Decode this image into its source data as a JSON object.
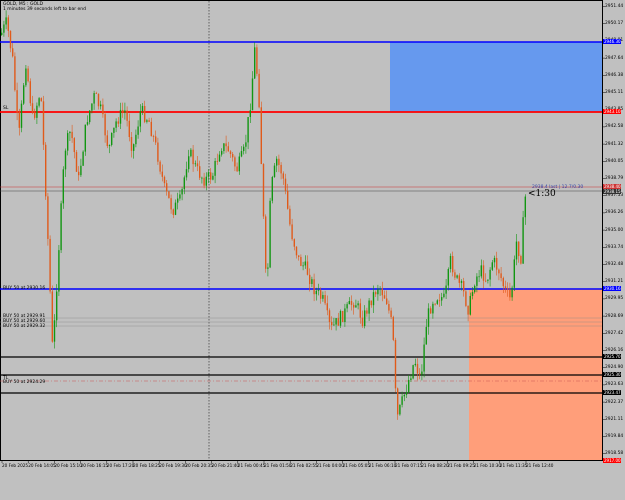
{
  "header": {
    "title": "GOLD, M5 : GOLD",
    "timer": "1 minutes 39 seconds left to bar end"
  },
  "countdown": "<1:30",
  "colors": {
    "background": "#c0c0c0",
    "bull": "#119611",
    "bear": "#e05a1a",
    "blue_line": "#0000ff",
    "red_line": "#ff0000",
    "supply_zone": "#6699ee",
    "demand_zone": "#ff9e7a"
  },
  "order_labels": {
    "sl_label": "SL",
    "buy_main": "BUY 50 at 2930.16",
    "buy_list": [
      "BUY 50 at 2929.91",
      "BUY 50 at 2929.60",
      "BUY 50 at 2929.32"
    ],
    "tl_label": "TL",
    "buy_low": "BUY 50 at 2924.29",
    "last_trade": "2938.4 last | 12.7/0.30"
  },
  "price_axis": [
    "2951.44",
    "2950.17",
    "2948.91",
    "2947.64",
    "2946.38",
    "2945.11",
    "2943.85",
    "2942.58",
    "2941.32",
    "2940.05",
    "2938.79",
    "2937.53",
    "2936.26",
    "2935.00",
    "2933.74",
    "2932.48",
    "2931.21",
    "2929.95",
    "2928.69",
    "2927.42",
    "2926.16",
    "2924.90",
    "2923.63",
    "2922.37",
    "2921.11",
    "2919.84",
    "2918.58"
  ],
  "price_badges": {
    "blue_top": "2946.30",
    "red_line": "2943.10",
    "current": "2938.40",
    "current2": "2938.15",
    "blue_mid": "2930.16",
    "black_1": "2925.70",
    "black_2": "2925.30",
    "black_3": "2923.47",
    "bottom": "2917.00"
  },
  "date_axis": [
    "20 Feb 2025",
    "20 Feb 14:05",
    "20 Feb 15:10",
    "20 Feb 16:15",
    "20 Feb 17:20",
    "20 Feb 18:25",
    "20 Feb 19:30",
    "20 Feb 20:35",
    "20 Feb 21:40",
    "21 Feb 00:45",
    "21 Feb 01:50",
    "21 Feb 02:55",
    "21 Feb 04:00",
    "21 Feb 05:05",
    "21 Feb 06:10",
    "21 Feb 07:15",
    "21 Feb 08:20",
    "21 Feb 09:25",
    "21 Feb 10:30",
    "21 Feb 11:35",
    "21 Feb 12:40"
  ]
}
